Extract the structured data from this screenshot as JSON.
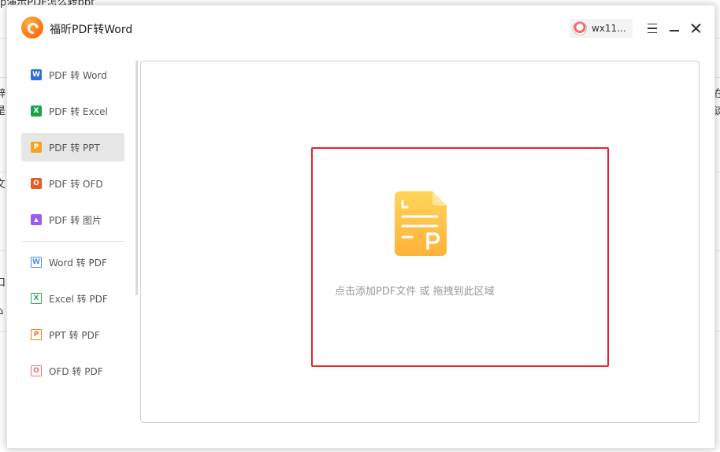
{
  "background": {
    "title_fragment": "p演示PDF怎么转ppt",
    "fragments": [
      {
        "id": "l1",
        "text": "辞"
      },
      {
        "id": "l2",
        "text": "是"
      },
      {
        "id": "l3",
        "text": "文"
      },
      {
        "id": "l4",
        "text": "口"
      },
      {
        "id": "l5",
        "text": "⌂"
      },
      {
        "id": "r1",
        "text": "在"
      },
      {
        "id": "r2",
        "text": "谈"
      }
    ]
  },
  "app": {
    "title": "福昕PDF转Word",
    "logo_icon": "foxit-logo-icon",
    "user": {
      "name": "wx11...",
      "avatar_icon": "user-avatar-icon"
    },
    "controls": {
      "menu_icon": "hamburger-menu-icon",
      "minimize_icon": "minimize-icon",
      "close_icon": "close-icon"
    }
  },
  "sidebar": {
    "items": [
      {
        "label": "PDF 转 Word",
        "icon_letter": "W",
        "icon_color": "#2b6fe0",
        "icon": "word-icon",
        "active": false
      },
      {
        "label": "PDF 转 Excel",
        "icon_letter": "X",
        "icon_color": "#1ca34a",
        "icon": "excel-icon",
        "active": false
      },
      {
        "label": "PDF 转 PPT",
        "icon_letter": "P",
        "icon_color": "#f3a51f",
        "icon": "ppt-icon",
        "active": true
      },
      {
        "label": "PDF 转 OFD",
        "icon_letter": "O",
        "icon_color": "#e85a24",
        "icon": "ofd-icon",
        "active": false
      },
      {
        "label": "PDF 转 图片",
        "icon_letter": "▲",
        "icon_color": "#9b5cf0",
        "icon": "image-icon",
        "active": false
      },
      {
        "label": "Word 转 PDF",
        "icon_letter": "W",
        "icon_color": "#4f8ef0",
        "icon": "word-doc-icon",
        "active": false
      },
      {
        "label": "Excel 转 PDF",
        "icon_letter": "X",
        "icon_color": "#2eaa55",
        "icon": "excel-doc-icon",
        "active": false
      },
      {
        "label": "PPT 转 PDF",
        "icon_letter": "P",
        "icon_color": "#f07a2a",
        "icon": "ppt-doc-icon",
        "active": false
      },
      {
        "label": "OFD 转 PDF",
        "icon_letter": "O",
        "icon_color": "#f07070",
        "icon": "ofd-doc-icon",
        "active": false
      }
    ]
  },
  "main": {
    "drop_zone": {
      "hint": "点击添加PDF文件 或 拖拽到此区域",
      "icon": "ppt-file-icon",
      "highlight_color": "#e8232a"
    }
  },
  "colors": {
    "accent_orange": "#ff7a1a",
    "active_bg": "#e6e6e6",
    "file_icon_gradient": [
      "#ffd45a",
      "#ffb238"
    ]
  }
}
